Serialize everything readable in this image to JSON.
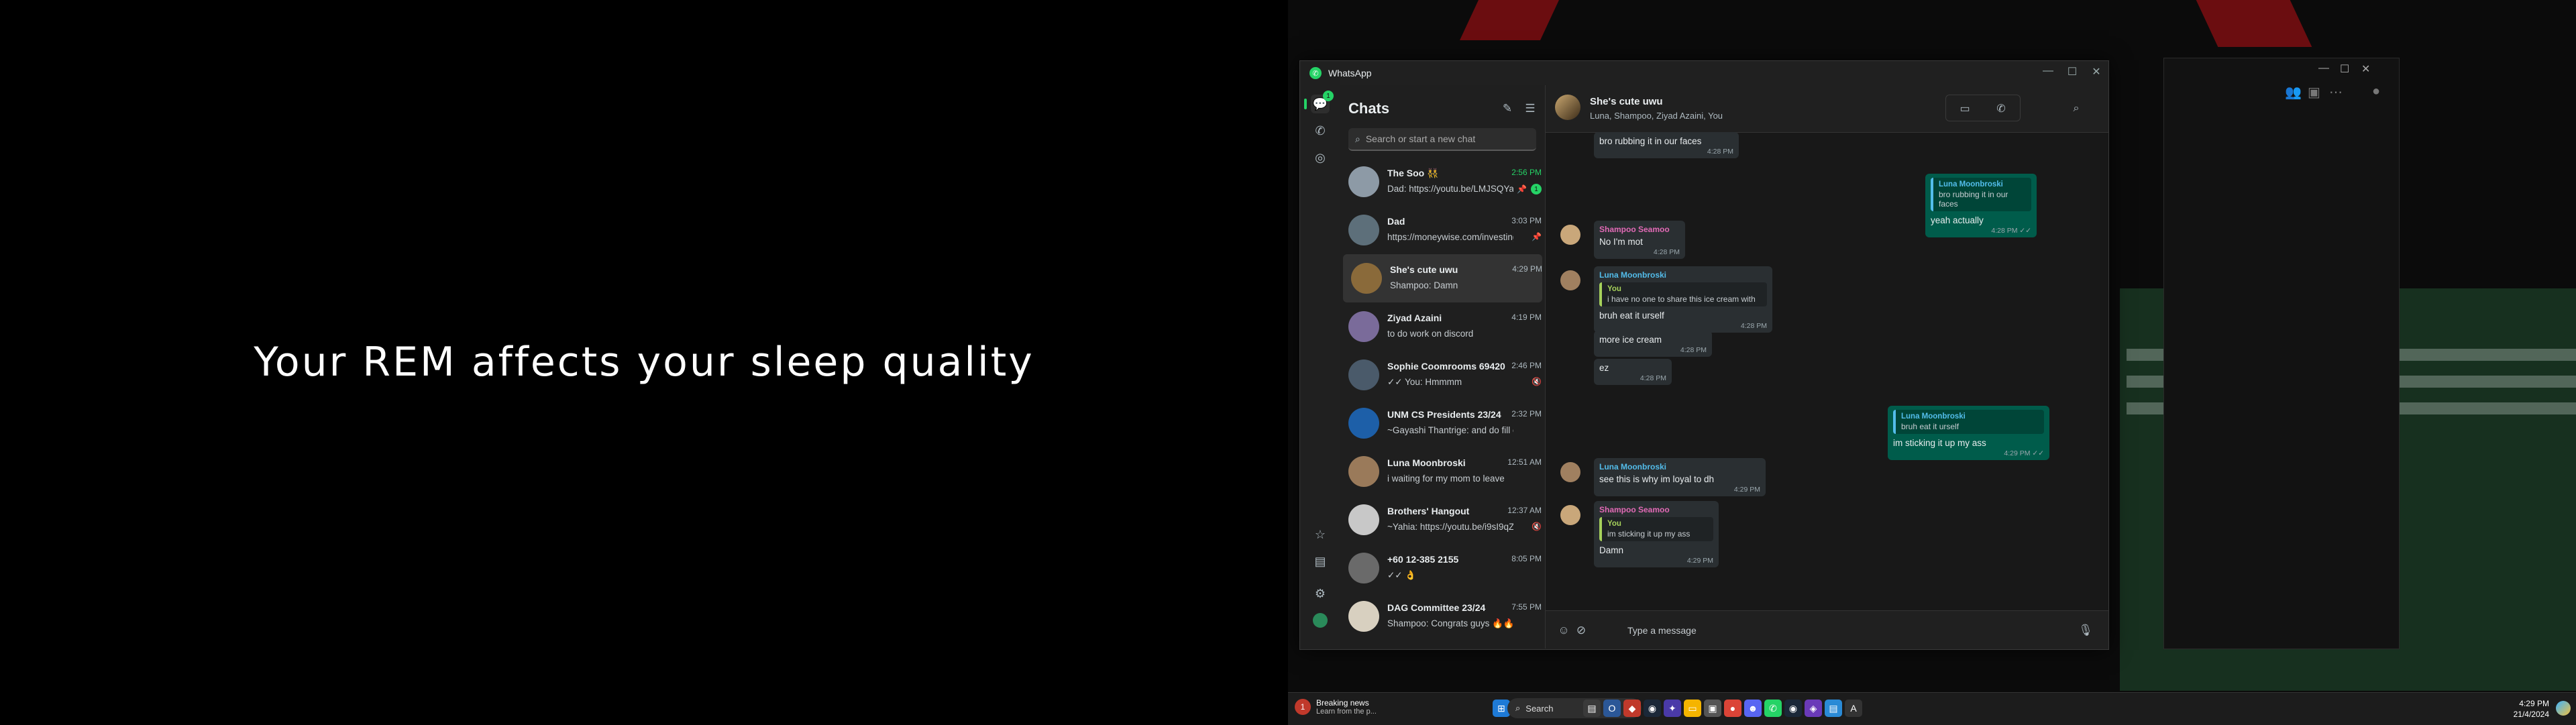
{
  "left_screen": {
    "banner_text": "Your REM affects your sleep quality"
  },
  "app": {
    "title": "WhatsApp",
    "rail_badge": "1",
    "window_controls": [
      "—",
      "☐",
      "✕"
    ]
  },
  "chatlist": {
    "header": "Chats",
    "search_placeholder": "Search or start a new chat",
    "items": [
      {
        "name": "The Soo 👯",
        "time": "2:56 PM",
        "time_unread": true,
        "message": "Dad: https://youtu.be/LMJSQYacP...",
        "pinned": "📌",
        "unread": "1",
        "avatar": "#8d9aa6"
      },
      {
        "name": "Dad",
        "time": "3:03 PM",
        "message": "https://moneywise.com/investing/inve...",
        "pinned": "📌",
        "avatar": "#5d6f7a"
      },
      {
        "name": "She's cute uwu",
        "time": "4:29 PM",
        "message": "Shampoo: Damn",
        "avatar": "#8a6a3a"
      },
      {
        "name": "Ziyad Azaini",
        "time": "4:19 PM",
        "message": "to do work on discord",
        "avatar": "#7a6b9a"
      },
      {
        "name": "Sophie Coomrooms 69420",
        "time": "2:46 PM",
        "message": "✓✓ You: Hmmmm",
        "muted": "🔇",
        "avatar": "#4a5a6a"
      },
      {
        "name": "UNM CS Presidents 23/24",
        "time": "2:32 PM",
        "message": "~Gayashi Thantrige: and do fill out the...",
        "avatar": "#1d5fa8"
      },
      {
        "name": "Luna Moonbroski",
        "time": "12:51 AM",
        "message": "i waiting for my mom to leave",
        "avatar": "#9a7a5a"
      },
      {
        "name": "Brothers' Hangout",
        "time": "12:37 AM",
        "message": "~Yahia: https://youtu.be/i9sI9qZXWPQ...",
        "muted": "🔇",
        "avatar": "#c8c8c8"
      },
      {
        "name": "+60 12-385 2155",
        "time": "8:05 PM",
        "message": "✓✓ 👌",
        "avatar": "#6a6a6a"
      },
      {
        "name": "DAG Committee 23/24",
        "time": "7:55 PM",
        "message": "Shampoo: Congrats guys 🔥🔥🔥❤️❤️...",
        "avatar": "#d8d0c0"
      }
    ]
  },
  "conversation": {
    "name": "She's cute uwu",
    "members": "Luna, Shampoo, Ziyad Azaini, You",
    "composer_placeholder": "Type a message",
    "messages": [
      {
        "text": "bro rubbing it in our faces",
        "time": "4:28 PM"
      },
      {
        "quote_name": "Luna Moonbroski",
        "quote_text": "bro rubbing it in our faces",
        "text": "yeah actually",
        "time": "4:28 PM ✓✓"
      },
      {
        "sender": "Shampoo Seamoo",
        "text": "No I'm mot",
        "time": "4:28 PM"
      },
      {
        "sender": "Luna Moonbroski",
        "quote_name": "You",
        "quote_text": "i have no one to share this ice cream with",
        "text": "bruh eat it urself",
        "time": "4:28 PM"
      },
      {
        "text": "more ice cream",
        "time": "4:28 PM"
      },
      {
        "text": "ez",
        "time": "4:28 PM"
      },
      {
        "quote_name": "Luna Moonbroski",
        "quote_text": "bruh eat it urself",
        "text": "im sticking it up my ass",
        "time": "4:29 PM ✓✓"
      },
      {
        "sender": "Luna Moonbroski",
        "text": "see this is why im loyal to dh",
        "time": "4:29 PM"
      },
      {
        "sender": "Shampoo Seamoo",
        "quote_name": "You",
        "quote_text": "im sticking it up my ass",
        "text": "Damn",
        "time": "4:29 PM"
      }
    ]
  },
  "taskbar": {
    "news_title": "Breaking news",
    "news_sub": "Learn from the p...",
    "news_badge": "1",
    "search_label": "Search",
    "time": "4:29 PM",
    "date": "21/4/2024"
  }
}
